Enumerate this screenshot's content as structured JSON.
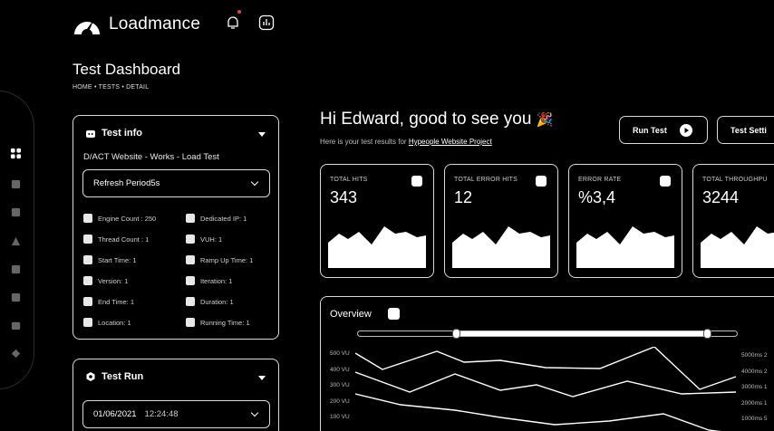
{
  "app": {
    "name": "Loadmance"
  },
  "page": {
    "title": "Test Dashboard",
    "breadcrumb": "HOME • TESTS • DETAIL"
  },
  "test_info": {
    "title": "Test info",
    "name": "D/ACT Website - Works - Load Test",
    "refresh_select": "Refresh Period5s",
    "items": [
      {
        "label": "Engine Count : 250",
        "icon": "engine-icon"
      },
      {
        "label": "Dedicated IP: 1",
        "icon": "ip-icon"
      },
      {
        "label": "Thread Count : 1",
        "icon": "thread-icon"
      },
      {
        "label": "VUH: 1",
        "icon": "user-icon"
      },
      {
        "label": "Start Time: 1",
        "icon": "stopwatch-icon"
      },
      {
        "label": "Ramp Up Time: 1",
        "icon": "ramp-icon"
      },
      {
        "label": "Version: 1",
        "icon": "version-icon"
      },
      {
        "label": "Iteration: 1",
        "icon": "iteration-icon"
      },
      {
        "label": "End Time: 1",
        "icon": "end-time-icon"
      },
      {
        "label": "Duration: 1",
        "icon": "duration-icon"
      },
      {
        "label": "Location: 1",
        "icon": "location-icon"
      },
      {
        "label": "Running Time: 1",
        "icon": "running-time-icon"
      }
    ]
  },
  "test_run": {
    "title": "Test Run",
    "date": "01/06/2021",
    "time": "12:24:48"
  },
  "greeting": {
    "headline": "Hi Edward, good to see you",
    "emoji": "🎉",
    "subtitle": "Here is your test results for ",
    "project": "Hypeople Website Project"
  },
  "actions": {
    "run_test": "Run Test",
    "test_settings": "Test Setti"
  },
  "stats": [
    {
      "label": "TOTAL HITS",
      "value": "343"
    },
    {
      "label": "TOTAL ERROR HITS",
      "value": "12"
    },
    {
      "label": "ERROR RATE",
      "value": "%3,4"
    },
    {
      "label": "TOTAL THROUGHPU",
      "value": "3244"
    }
  ],
  "overview": {
    "title": "Overview",
    "y_left": [
      "500 VU",
      "400 VU",
      "300 VU",
      "200 VU",
      "100 VU"
    ],
    "y_right": [
      "5000ms 2",
      "4000ms 2",
      "3000ms 1",
      "2000ms 1",
      "1000ms 5"
    ]
  },
  "colors": {
    "background": "#000000",
    "accent": "#ffffff",
    "notification": "#e0443c"
  }
}
